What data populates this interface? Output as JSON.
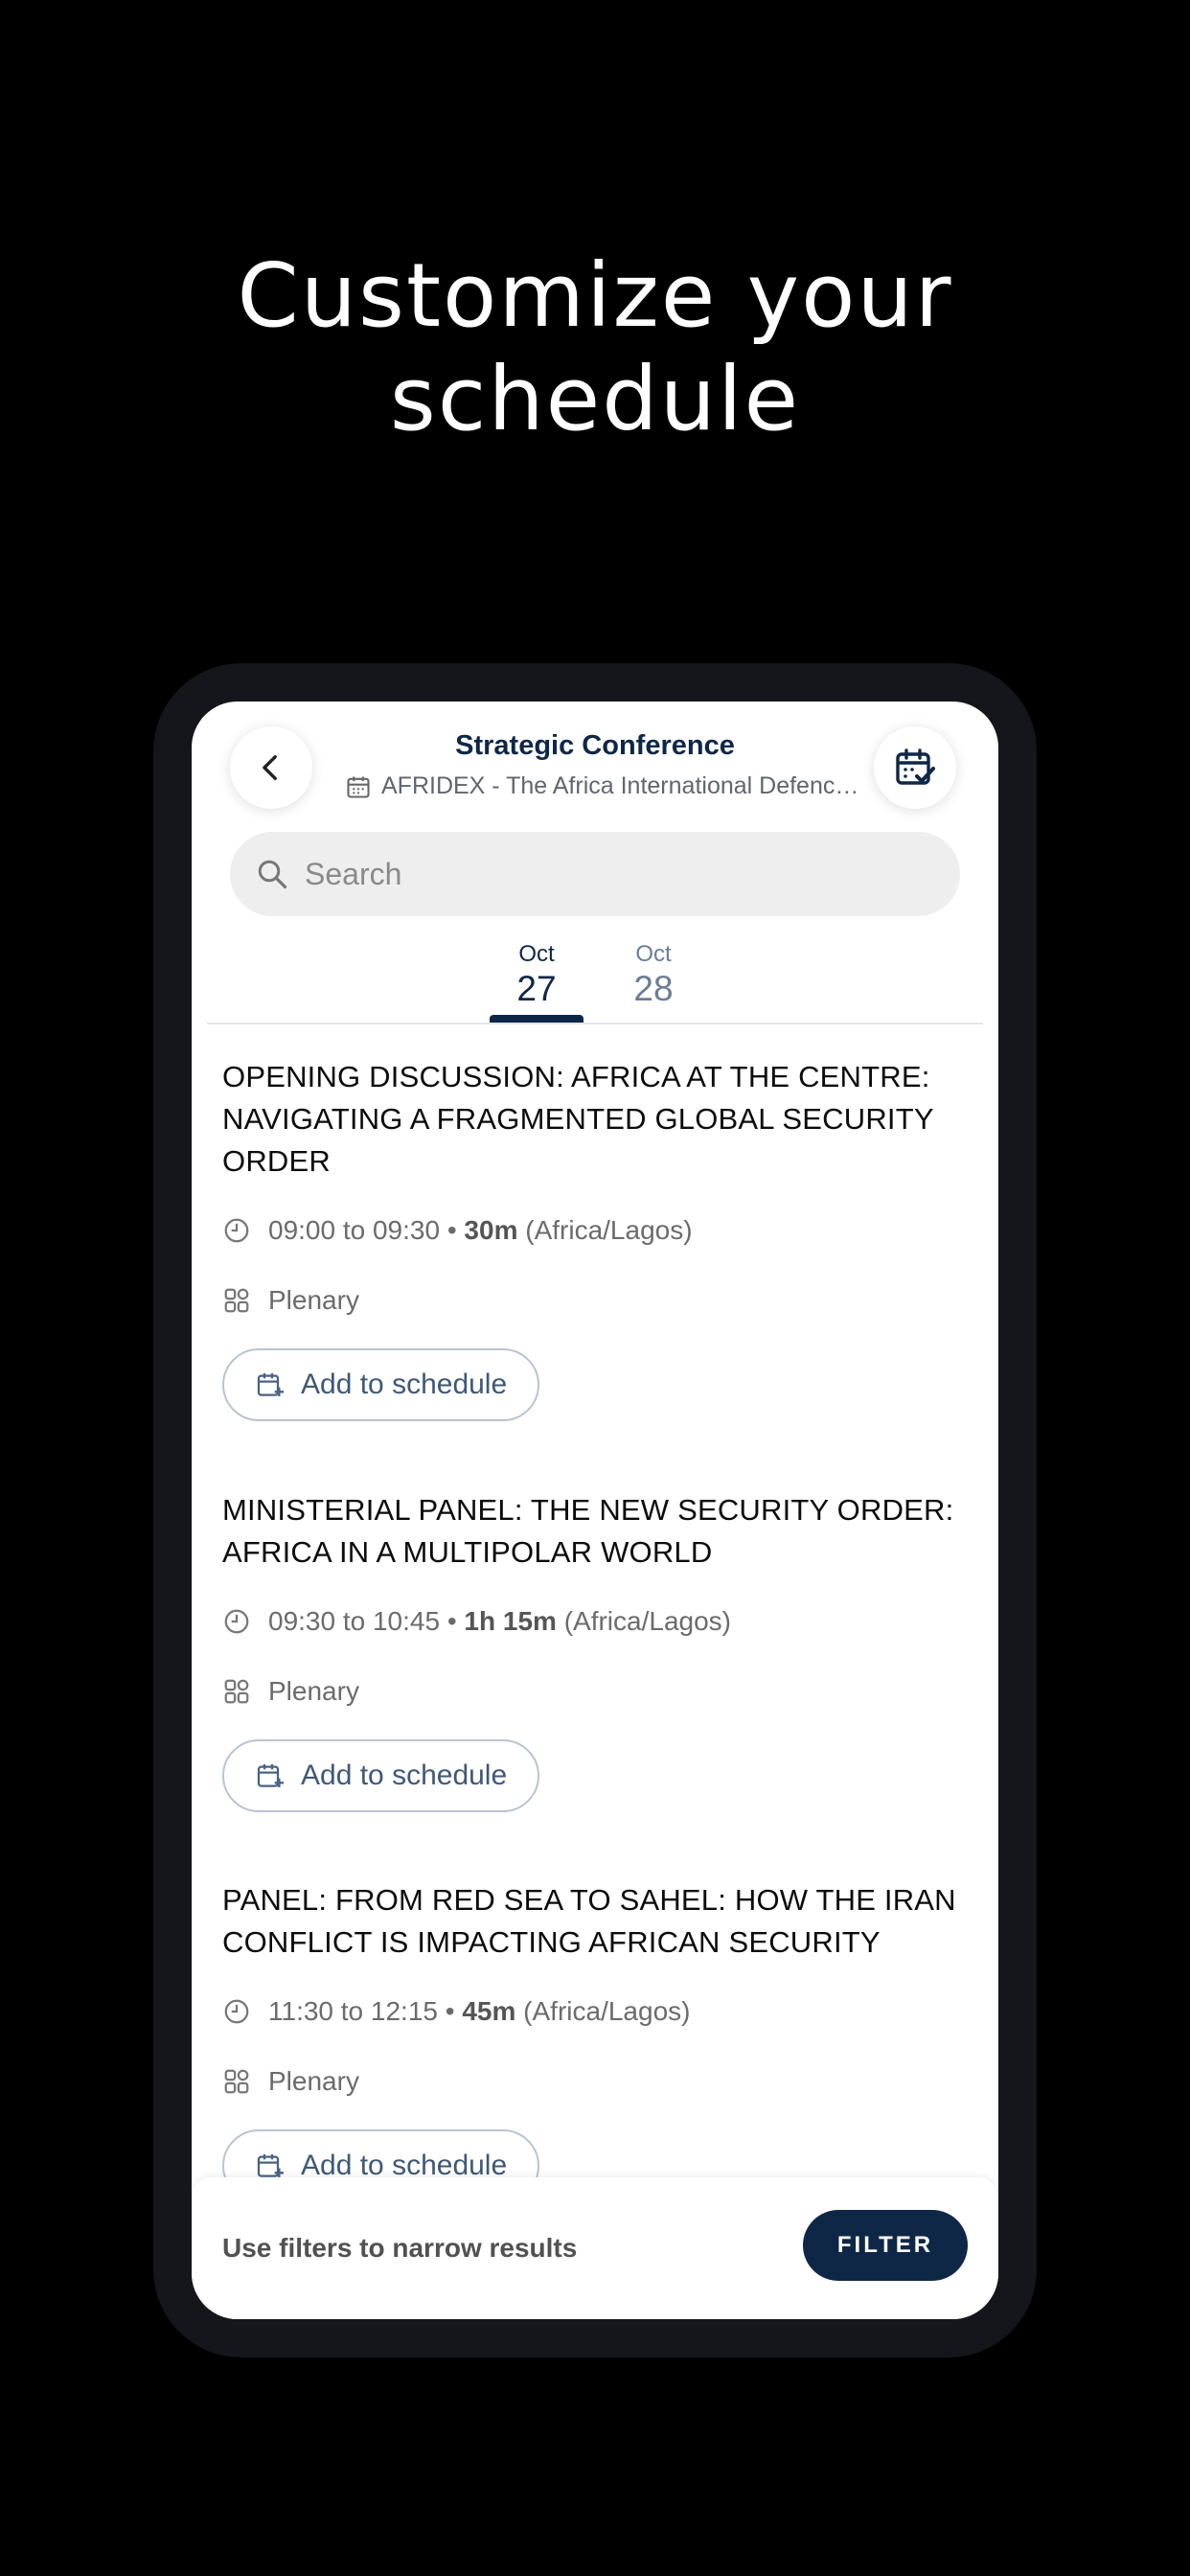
{
  "headline": {
    "line1": "Customize your",
    "line2": "schedule"
  },
  "header": {
    "title": "Strategic Conference",
    "subtitle": "AFRIDEX - The Africa International Defence & Security Exhibition"
  },
  "search": {
    "placeholder": "Search"
  },
  "date_tabs": [
    {
      "month": "Oct",
      "day": "27",
      "active": true
    },
    {
      "month": "Oct",
      "day": "28",
      "active": false
    }
  ],
  "sessions": [
    {
      "title_line1": "OPENING DISCUSSION: AFRICA AT THE CENTRE:",
      "title_line2": "NAVIGATING A FRAGMENTED GLOBAL SECURITY",
      "title_line3": "ORDER",
      "time": "09:00 to 09:30 •",
      "duration": "30m",
      "timezone": "(Africa/Lagos)",
      "track": "Plenary",
      "button_label": "Add to schedule"
    },
    {
      "title_line1": "MINISTERIAL PANEL: THE NEW SECURITY ORDER:",
      "title_line2": "AFRICA IN A MULTIPOLAR WORLD",
      "time": "09:30 to 10:45 •",
      "duration": "1h 15m",
      "timezone": "(Africa/Lagos)",
      "track": "Plenary",
      "button_label": "Add to schedule"
    },
    {
      "title_line1": "PANEL: FROM RED SEA TO SAHEL: HOW THE IRAN",
      "title_line2": "CONFLICT IS IMPACTING AFRICAN SECURITY",
      "time": "11:30 to 12:15 •",
      "duration": "45m",
      "timezone": "(Africa/Lagos)",
      "track": "Plenary",
      "button_label": "Add to schedule"
    }
  ],
  "bottom_bar": {
    "hint": "Use filters to narrow results",
    "filter_label": "FILTER"
  },
  "colors": {
    "primary": "#0f2747",
    "inactive_tab": "#6b7d96",
    "button_border": "#b9c3d3"
  }
}
